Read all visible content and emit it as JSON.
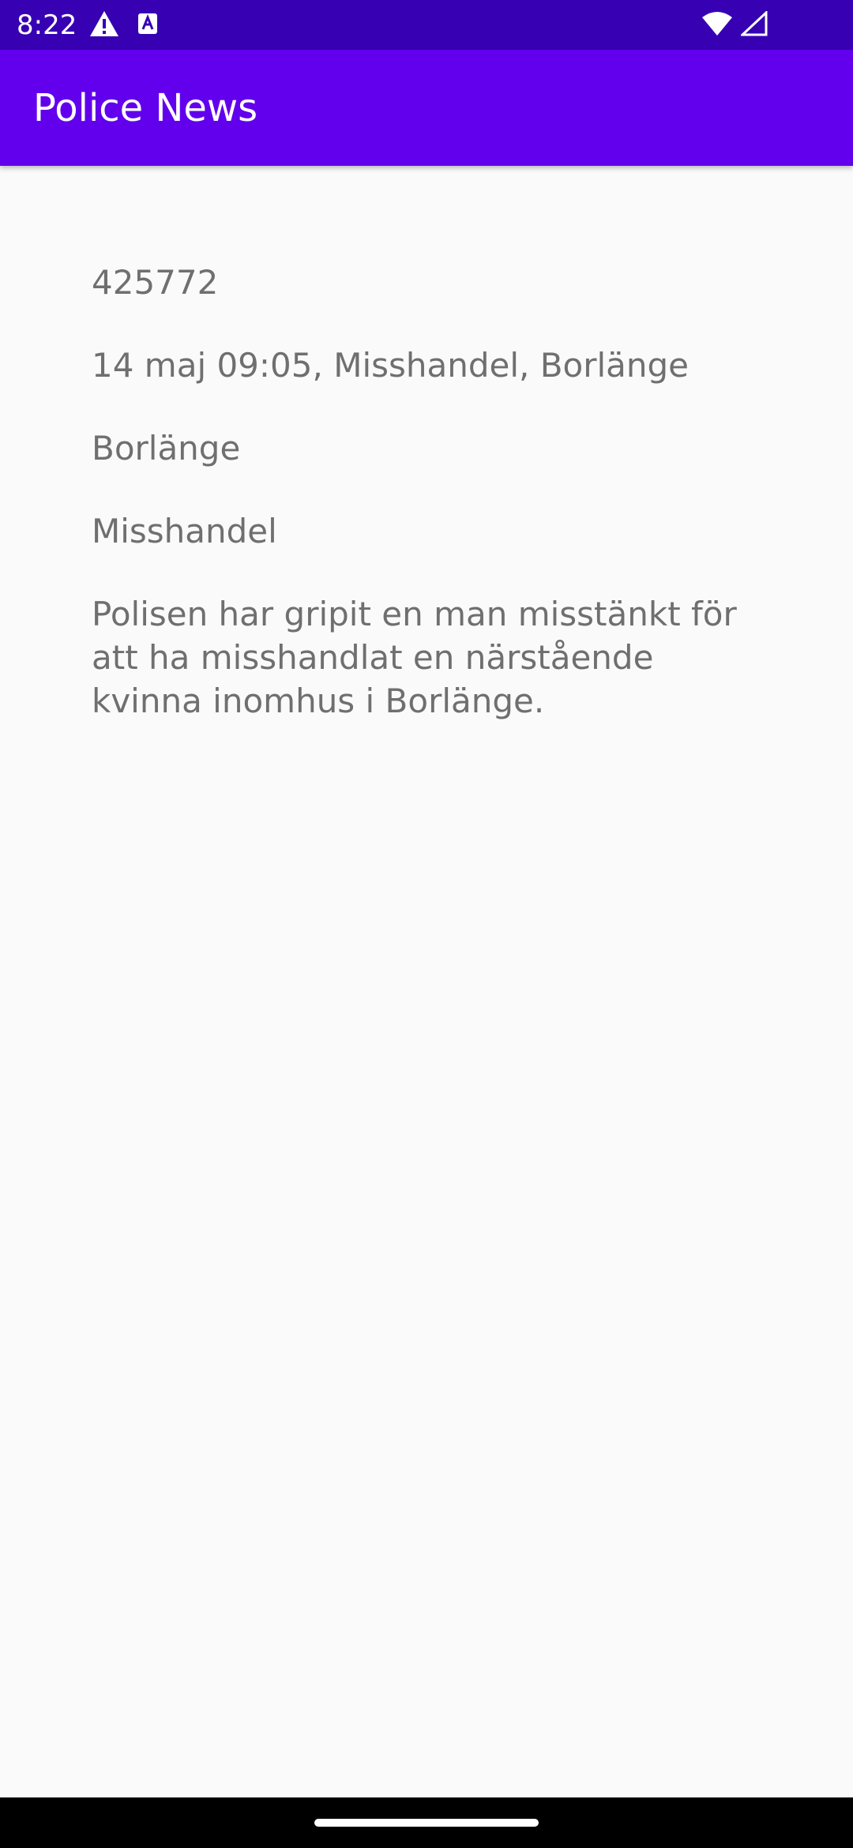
{
  "status_bar": {
    "time": "8:22",
    "icons": [
      "alert-icon",
      "sim-a-icon",
      "wifi-icon",
      "signal-icon"
    ]
  },
  "app_bar": {
    "title": "Police News",
    "color": "#6200ee",
    "status_color": "#3700b3"
  },
  "event": {
    "id": "425772",
    "name": "14 maj 09:05, Misshandel, Borlänge",
    "location": "Borlänge",
    "type": "Misshandel",
    "summary": "Polisen har gripit en man misstänkt för att ha misshandlat en närstående kvinna inomhus i Borlänge."
  }
}
